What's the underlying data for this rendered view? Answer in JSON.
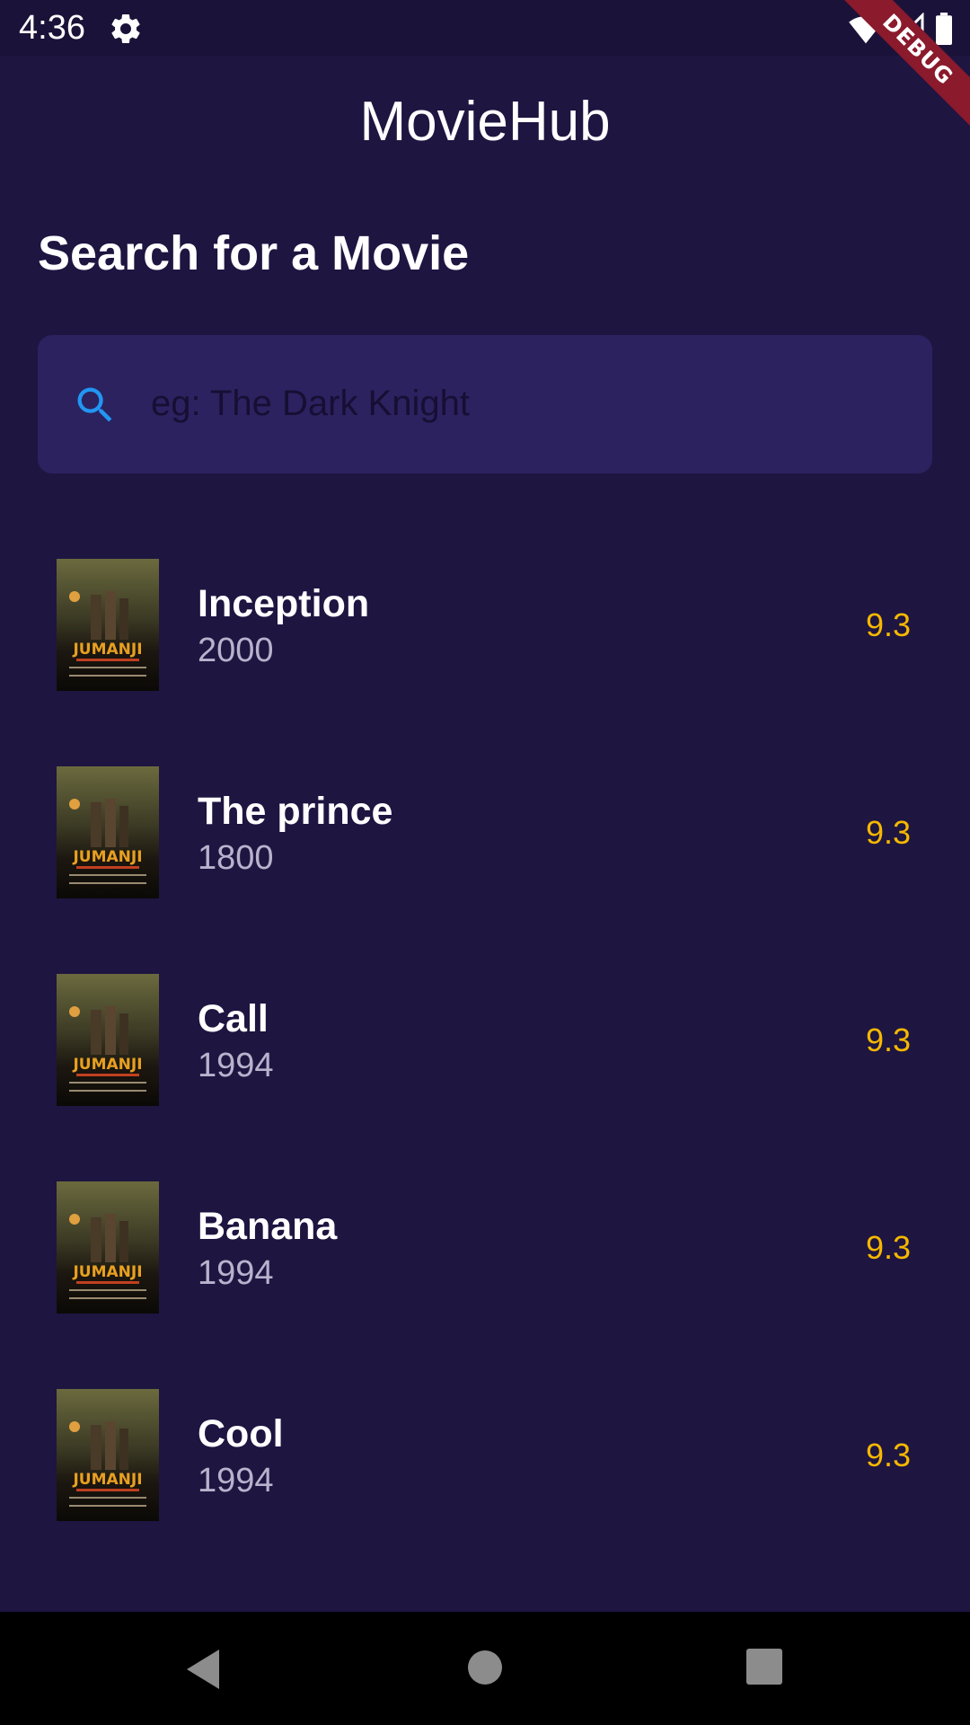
{
  "status_bar": {
    "time": "4:36",
    "icons": [
      "gear-icon",
      "wifi-icon",
      "signal-icon",
      "battery-icon"
    ]
  },
  "debug_banner": "DEBUG",
  "app": {
    "title": "MovieHub"
  },
  "search": {
    "heading": "Search for a Movie",
    "placeholder": "eg: The Dark Knight",
    "value": ""
  },
  "movies": [
    {
      "title": "Inception",
      "year": "2000",
      "rating": "9.3"
    },
    {
      "title": "The prince",
      "year": "1800",
      "rating": "9.3"
    },
    {
      "title": "Call",
      "year": "1994",
      "rating": "9.3"
    },
    {
      "title": "Banana",
      "year": "1994",
      "rating": "9.3"
    },
    {
      "title": "Cool",
      "year": "1994",
      "rating": "9.3"
    }
  ],
  "colors": {
    "background": "#1e1541",
    "search_field": "#2c2260",
    "accent_blue": "#2196f3",
    "rating": "#f5b800",
    "debug_ribbon": "#8a1a2c"
  },
  "nav_bar": {
    "icons": [
      "back-icon",
      "home-icon",
      "recents-icon"
    ]
  }
}
